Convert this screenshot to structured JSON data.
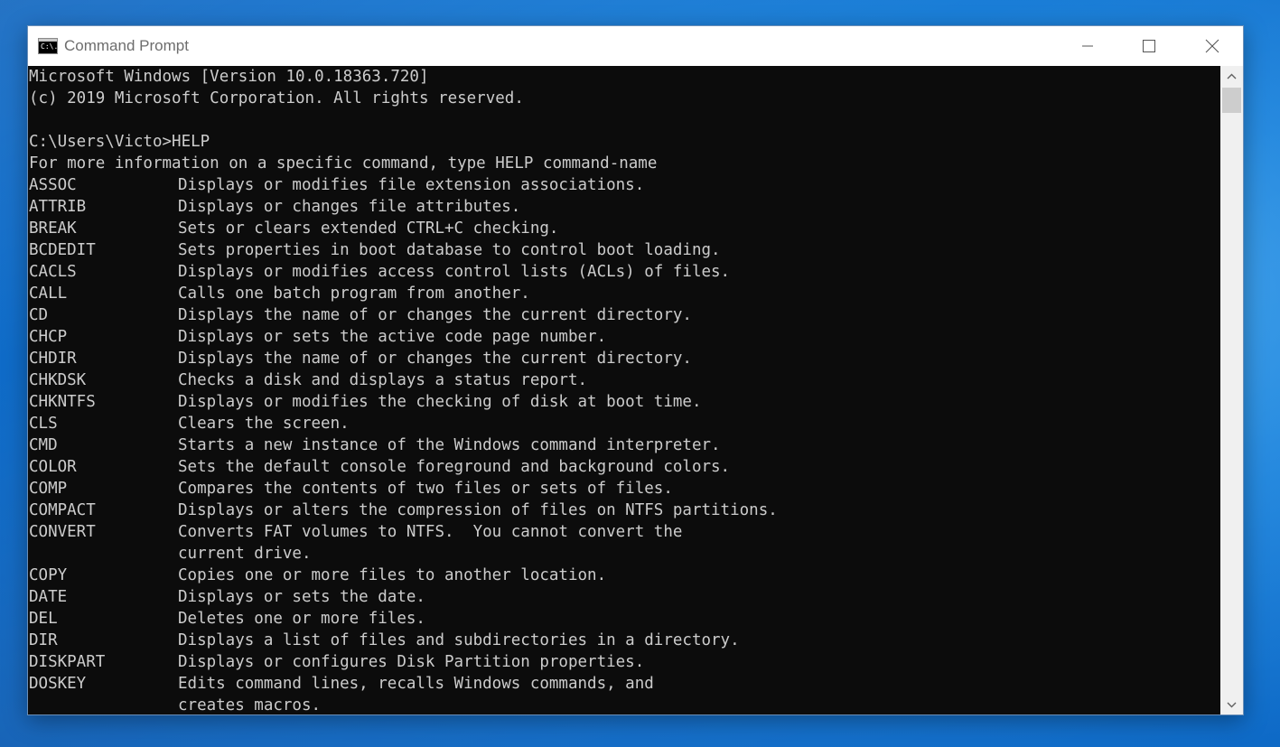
{
  "window": {
    "title": "Command Prompt",
    "icon_text": "C:\\."
  },
  "console": {
    "lines": [
      "Microsoft Windows [Version 10.0.18363.720]",
      "(c) 2019 Microsoft Corporation. All rights reserved.",
      "",
      "C:\\Users\\Victo>HELP",
      "For more information on a specific command, type HELP command-name"
    ],
    "commands": [
      {
        "name": "ASSOC",
        "desc": "Displays or modifies file extension associations."
      },
      {
        "name": "ATTRIB",
        "desc": "Displays or changes file attributes."
      },
      {
        "name": "BREAK",
        "desc": "Sets or clears extended CTRL+C checking."
      },
      {
        "name": "BCDEDIT",
        "desc": "Sets properties in boot database to control boot loading."
      },
      {
        "name": "CACLS",
        "desc": "Displays or modifies access control lists (ACLs) of files."
      },
      {
        "name": "CALL",
        "desc": "Calls one batch program from another."
      },
      {
        "name": "CD",
        "desc": "Displays the name of or changes the current directory."
      },
      {
        "name": "CHCP",
        "desc": "Displays or sets the active code page number."
      },
      {
        "name": "CHDIR",
        "desc": "Displays the name of or changes the current directory."
      },
      {
        "name": "CHKDSK",
        "desc": "Checks a disk and displays a status report."
      },
      {
        "name": "CHKNTFS",
        "desc": "Displays or modifies the checking of disk at boot time."
      },
      {
        "name": "CLS",
        "desc": "Clears the screen."
      },
      {
        "name": "CMD",
        "desc": "Starts a new instance of the Windows command interpreter."
      },
      {
        "name": "COLOR",
        "desc": "Sets the default console foreground and background colors."
      },
      {
        "name": "COMP",
        "desc": "Compares the contents of two files or sets of files."
      },
      {
        "name": "COMPACT",
        "desc": "Displays or alters the compression of files on NTFS partitions."
      },
      {
        "name": "CONVERT",
        "desc": "Converts FAT volumes to NTFS.  You cannot convert the"
      },
      {
        "name": "",
        "desc": "current drive."
      },
      {
        "name": "COPY",
        "desc": "Copies one or more files to another location."
      },
      {
        "name": "DATE",
        "desc": "Displays or sets the date."
      },
      {
        "name": "DEL",
        "desc": "Deletes one or more files."
      },
      {
        "name": "DIR",
        "desc": "Displays a list of files and subdirectories in a directory."
      },
      {
        "name": "DISKPART",
        "desc": "Displays or configures Disk Partition properties."
      },
      {
        "name": "DOSKEY",
        "desc": "Edits command lines, recalls Windows commands, and"
      },
      {
        "name": "",
        "desc": "creates macros."
      }
    ]
  },
  "colors": {
    "console_bg": "#0c0c0c",
    "console_fg": "#cccccc",
    "titlebar_bg": "#ffffff"
  },
  "icons": {
    "minimize": "minimize-icon",
    "maximize": "maximize-icon",
    "close": "close-icon",
    "scroll_up": "chevron-up-icon",
    "scroll_down": "chevron-down-icon"
  }
}
